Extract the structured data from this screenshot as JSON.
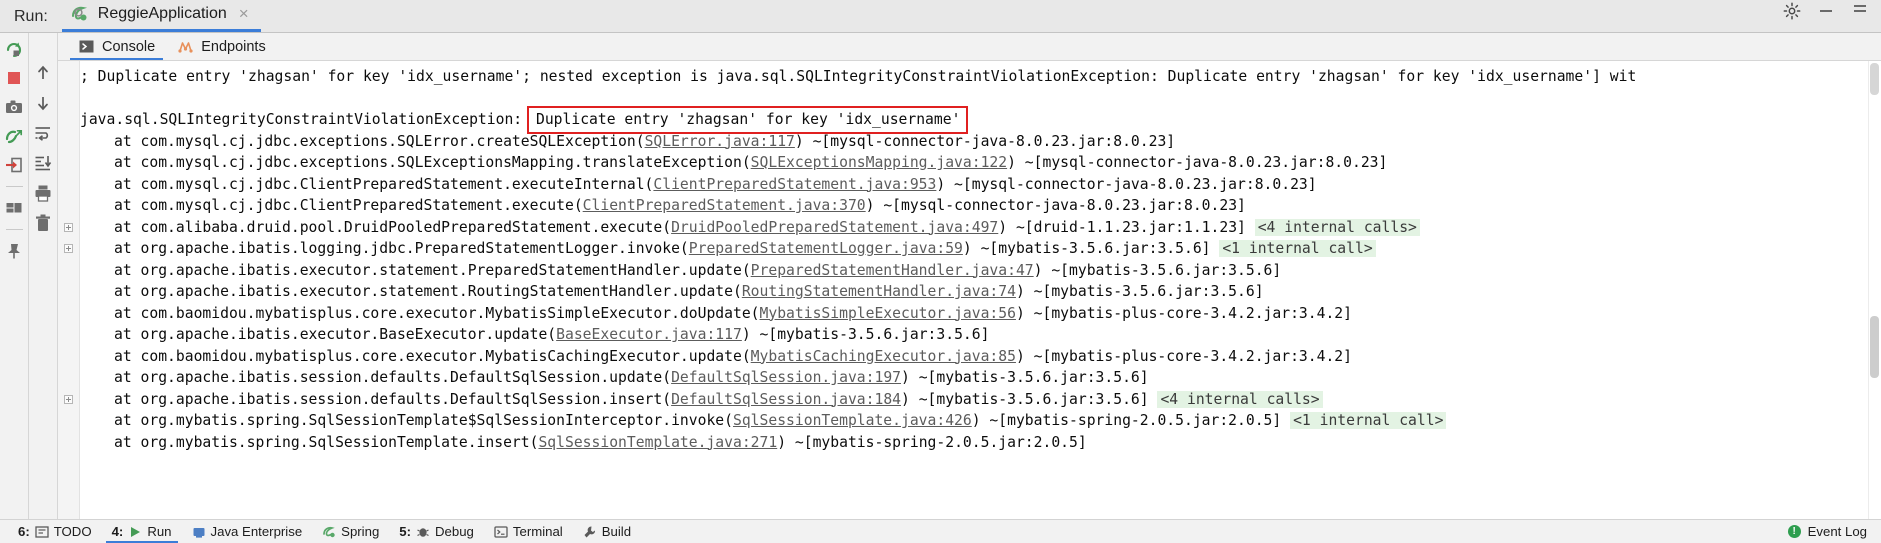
{
  "window": {
    "run_label": "Run:",
    "tab_title": "ReggieApplication",
    "tab_close": "×",
    "settings_icon": "gear-icon",
    "minimize_icon": "minimize-icon",
    "hide_icon": "hide-icon"
  },
  "left_rail": {
    "icons": [
      {
        "name": "rerun-icon",
        "title": "Rerun"
      },
      {
        "name": "stop-icon",
        "title": "Stop"
      },
      {
        "name": "camera-icon",
        "title": "Screenshot"
      },
      {
        "name": "thread-dump-icon",
        "title": "Thread Dump"
      },
      {
        "name": "open-in-icon",
        "title": "Restore Layout"
      },
      {
        "name": "layout-icon",
        "title": "Layout Settings"
      },
      {
        "name": "pin-icon",
        "title": "Pin Tab"
      }
    ]
  },
  "second_rail": {
    "icons": [
      {
        "name": "up-arrow-icon",
        "title": "Up"
      },
      {
        "name": "down-arrow-icon",
        "title": "Down"
      },
      {
        "name": "soft-wrap-icon",
        "title": "Soft-Wrap"
      },
      {
        "name": "scroll-to-end-icon",
        "title": "Scroll to End"
      },
      {
        "name": "print-icon",
        "title": "Print"
      },
      {
        "name": "trash-icon",
        "title": "Clear All"
      }
    ]
  },
  "subtabs": [
    {
      "label": "Console",
      "icon": "console-icon",
      "active": true
    },
    {
      "label": "Endpoints",
      "icon": "endpoints-icon",
      "active": false
    }
  ],
  "console": {
    "lines": [
      {
        "id": "line-0",
        "indent": false,
        "fold": false,
        "segments": [
          {
            "type": "text",
            "text": "; Duplicate entry 'zhagsan' for key 'idx_username'; nested exception is java.sql.SQLIntegrityConstraintViolationException: Duplicate entry 'zhagsan' for key 'idx_username'] wit"
          }
        ]
      },
      {
        "id": "line-blank",
        "indent": false,
        "fold": false,
        "segments": [
          {
            "type": "text",
            "text": ""
          }
        ]
      },
      {
        "id": "line-exception",
        "indent": false,
        "fold": false,
        "segments": [
          {
            "type": "text",
            "text": "java.sql.SQLIntegrityConstraintViolationException: "
          },
          {
            "type": "boxed",
            "text": "Duplicate entry 'zhagsan' for key 'idx_username'"
          }
        ]
      },
      {
        "id": "line-1",
        "indent": true,
        "fold": false,
        "segments": [
          {
            "type": "text",
            "text": "at com.mysql.cj.jdbc.exceptions.SQLError.createSQLException("
          },
          {
            "type": "link",
            "text": "SQLError.java:117"
          },
          {
            "type": "text",
            "text": ") ~[mysql-connector-java-8.0.23.jar:8.0.23]"
          }
        ]
      },
      {
        "id": "line-2",
        "indent": true,
        "fold": false,
        "segments": [
          {
            "type": "text",
            "text": "at com.mysql.cj.jdbc.exceptions.SQLExceptionsMapping.translateException("
          },
          {
            "type": "link",
            "text": "SQLExceptionsMapping.java:122"
          },
          {
            "type": "text",
            "text": ") ~[mysql-connector-java-8.0.23.jar:8.0.23]"
          }
        ]
      },
      {
        "id": "line-3",
        "indent": true,
        "fold": false,
        "segments": [
          {
            "type": "text",
            "text": "at com.mysql.cj.jdbc.ClientPreparedStatement.executeInternal("
          },
          {
            "type": "link",
            "text": "ClientPreparedStatement.java:953"
          },
          {
            "type": "text",
            "text": ") ~[mysql-connector-java-8.0.23.jar:8.0.23]"
          }
        ]
      },
      {
        "id": "line-4",
        "indent": true,
        "fold": false,
        "segments": [
          {
            "type": "text",
            "text": "at com.mysql.cj.jdbc.ClientPreparedStatement.execute("
          },
          {
            "type": "link",
            "text": "ClientPreparedStatement.java:370"
          },
          {
            "type": "text",
            "text": ") ~[mysql-connector-java-8.0.23.jar:8.0.23]"
          }
        ]
      },
      {
        "id": "line-5",
        "indent": true,
        "fold": true,
        "segments": [
          {
            "type": "text",
            "text": "at com.alibaba.druid.pool.DruidPooledPreparedStatement.execute("
          },
          {
            "type": "link",
            "text": "DruidPooledPreparedStatement.java:497"
          },
          {
            "type": "text",
            "text": ") ~[druid-1.1.23.jar:1.1.23] "
          },
          {
            "type": "badge",
            "text": "<4 internal calls>"
          }
        ]
      },
      {
        "id": "line-6",
        "indent": true,
        "fold": true,
        "segments": [
          {
            "type": "text",
            "text": "at org.apache.ibatis.logging.jdbc.PreparedStatementLogger.invoke("
          },
          {
            "type": "link",
            "text": "PreparedStatementLogger.java:59"
          },
          {
            "type": "text",
            "text": ") ~[mybatis-3.5.6.jar:3.5.6] "
          },
          {
            "type": "badge",
            "text": "<1 internal call>"
          }
        ]
      },
      {
        "id": "line-7",
        "indent": true,
        "fold": false,
        "segments": [
          {
            "type": "text",
            "text": "at org.apache.ibatis.executor.statement.PreparedStatementHandler.update("
          },
          {
            "type": "link",
            "text": "PreparedStatementHandler.java:47"
          },
          {
            "type": "text",
            "text": ") ~[mybatis-3.5.6.jar:3.5.6]"
          }
        ]
      },
      {
        "id": "line-8",
        "indent": true,
        "fold": false,
        "segments": [
          {
            "type": "text",
            "text": "at org.apache.ibatis.executor.statement.RoutingStatementHandler.update("
          },
          {
            "type": "link",
            "text": "RoutingStatementHandler.java:74"
          },
          {
            "type": "text",
            "text": ") ~[mybatis-3.5.6.jar:3.5.6]"
          }
        ]
      },
      {
        "id": "line-9",
        "indent": true,
        "fold": false,
        "segments": [
          {
            "type": "text",
            "text": "at com.baomidou.mybatisplus.core.executor.MybatisSimpleExecutor.doUpdate("
          },
          {
            "type": "link",
            "text": "MybatisSimpleExecutor.java:56"
          },
          {
            "type": "text",
            "text": ") ~[mybatis-plus-core-3.4.2.jar:3.4.2]"
          }
        ]
      },
      {
        "id": "line-10",
        "indent": true,
        "fold": false,
        "segments": [
          {
            "type": "text",
            "text": "at org.apache.ibatis.executor.BaseExecutor.update("
          },
          {
            "type": "link",
            "text": "BaseExecutor.java:117"
          },
          {
            "type": "text",
            "text": ") ~[mybatis-3.5.6.jar:3.5.6]"
          }
        ]
      },
      {
        "id": "line-11",
        "indent": true,
        "fold": false,
        "segments": [
          {
            "type": "text",
            "text": "at com.baomidou.mybatisplus.core.executor.MybatisCachingExecutor.update("
          },
          {
            "type": "link",
            "text": "MybatisCachingExecutor.java:85"
          },
          {
            "type": "text",
            "text": ") ~[mybatis-plus-core-3.4.2.jar:3.4.2]"
          }
        ]
      },
      {
        "id": "line-12",
        "indent": true,
        "fold": false,
        "segments": [
          {
            "type": "text",
            "text": "at org.apache.ibatis.session.defaults.DefaultSqlSession.update("
          },
          {
            "type": "link",
            "text": "DefaultSqlSession.java:197"
          },
          {
            "type": "text",
            "text": ") ~[mybatis-3.5.6.jar:3.5.6]"
          }
        ]
      },
      {
        "id": "line-13",
        "indent": true,
        "fold": true,
        "segments": [
          {
            "type": "text",
            "text": "at org.apache.ibatis.session.defaults.DefaultSqlSession.insert("
          },
          {
            "type": "link",
            "text": "DefaultSqlSession.java:184"
          },
          {
            "type": "text",
            "text": ") ~[mybatis-3.5.6.jar:3.5.6] "
          },
          {
            "type": "badge",
            "text": "<4 internal calls>"
          }
        ]
      },
      {
        "id": "line-14",
        "indent": true,
        "fold": false,
        "segments": [
          {
            "type": "text",
            "text": "at org.mybatis.spring.SqlSessionTemplate$SqlSessionInterceptor.invoke("
          },
          {
            "type": "link",
            "text": "SqlSessionTemplate.java:426"
          },
          {
            "type": "text",
            "text": ") ~[mybatis-spring-2.0.5.jar:2.0.5] "
          },
          {
            "type": "badge",
            "text": "<1 internal call>"
          }
        ]
      },
      {
        "id": "line-15",
        "indent": true,
        "fold": false,
        "segments": [
          {
            "type": "text",
            "text": "at org.mybatis.spring.SqlSessionTemplate.insert("
          },
          {
            "type": "link",
            "text": "SqlSessionTemplate.java:271"
          },
          {
            "type": "text",
            "text": ") ~[mybatis-spring-2.0.5.jar:2.0.5]"
          }
        ]
      }
    ]
  },
  "statusbar": {
    "items": [
      {
        "num": "6:",
        "label": "TODO",
        "icon": "todo-icon",
        "active": false
      },
      {
        "num": "4:",
        "label": "Run",
        "icon": "run-icon",
        "active": true
      },
      {
        "num": "",
        "label": "Java Enterprise",
        "icon": "java-enterprise-icon",
        "active": false
      },
      {
        "num": "",
        "label": "Spring",
        "icon": "spring-icon",
        "active": false
      },
      {
        "num": "5:",
        "label": "Debug",
        "icon": "debug-icon",
        "active": false
      },
      {
        "num": "",
        "label": "Terminal",
        "icon": "terminal-icon",
        "active": false
      },
      {
        "num": "",
        "label": "Build",
        "icon": "build-icon",
        "active": false
      }
    ],
    "event_log": "Event Log",
    "event_log_icon": "event-log-icon"
  }
}
